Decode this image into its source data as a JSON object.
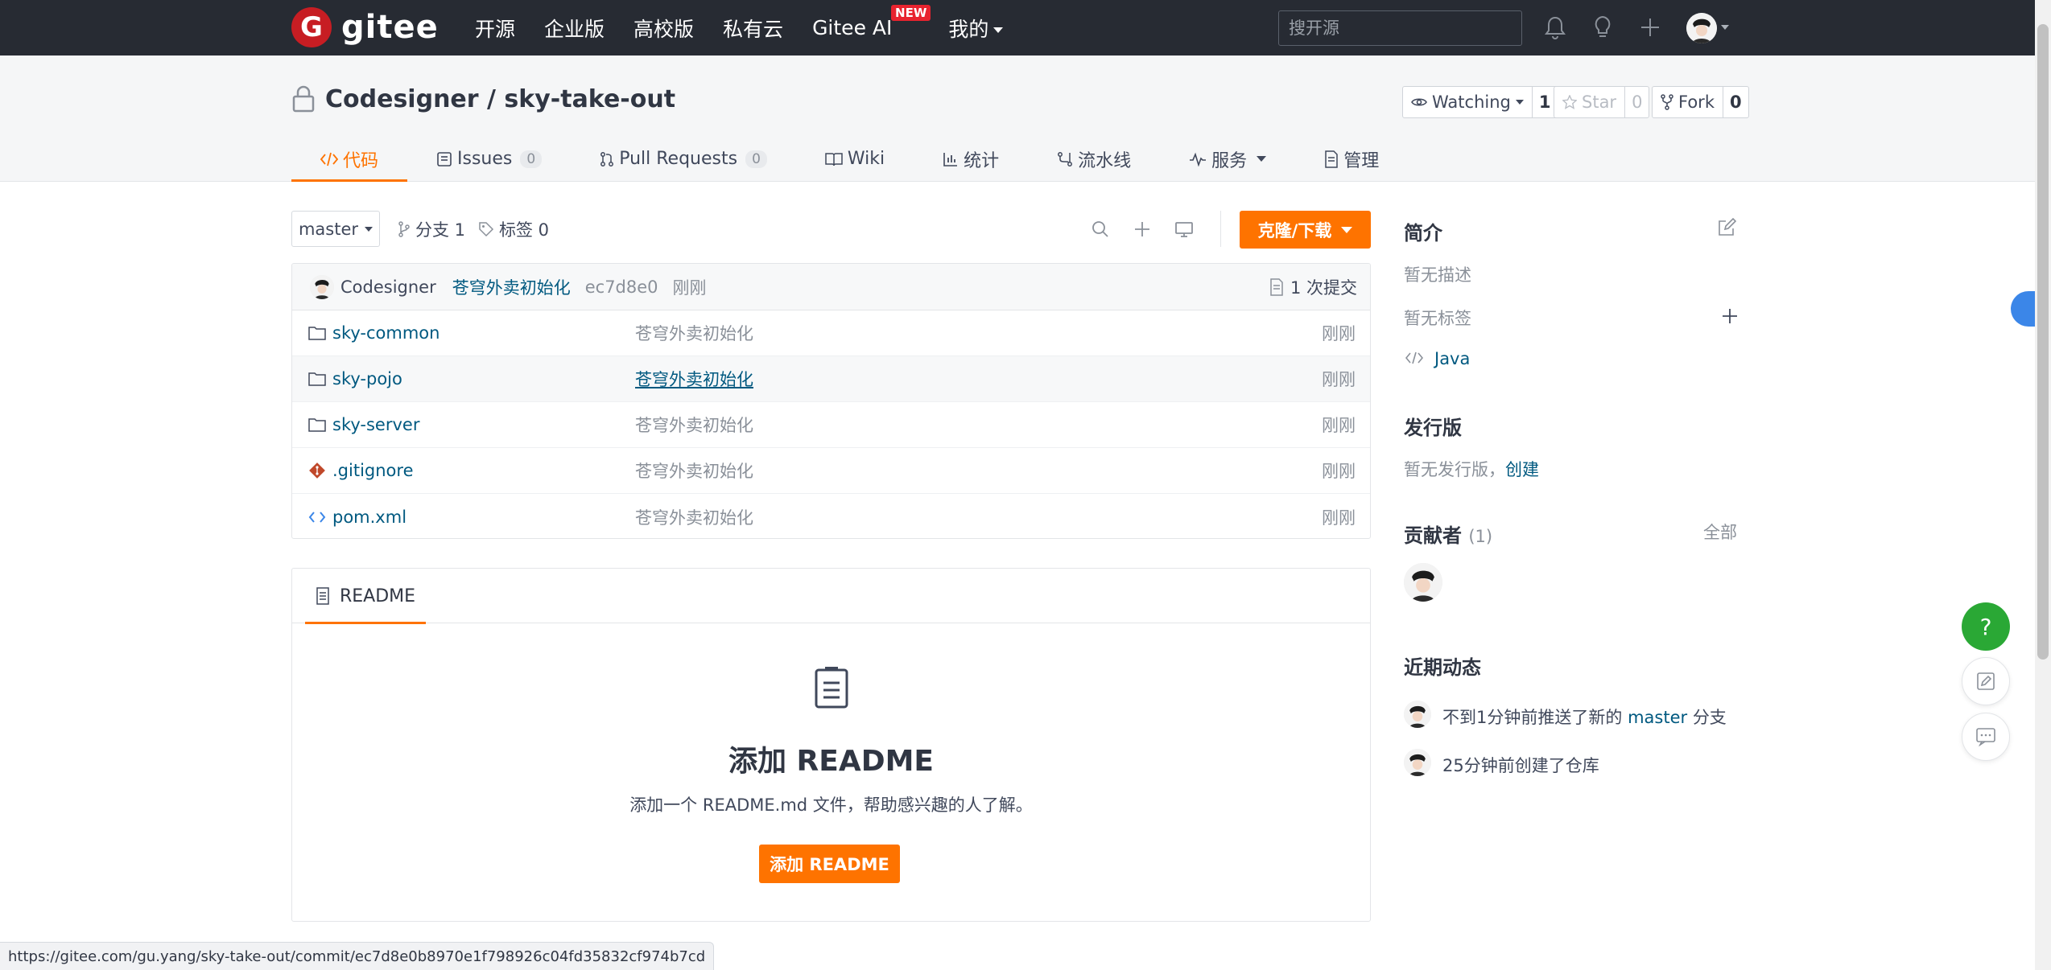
{
  "topnav": {
    "logo_text": "gitee",
    "items": [
      "开源",
      "企业版",
      "高校版",
      "私有云",
      "Gitee AI",
      "我的"
    ],
    "new_badge": "NEW",
    "search_placeholder": "搜开源"
  },
  "repo": {
    "title": "Codesigner / sky-take-out",
    "watching_label": "Watching",
    "watching_count": "1",
    "star_label": "Star",
    "star_count": "0",
    "fork_label": "Fork",
    "fork_count": "0"
  },
  "tabs": [
    {
      "label": "代码",
      "active": true
    },
    {
      "label": "Issues",
      "badge": "0"
    },
    {
      "label": "Pull Requests",
      "badge": "0"
    },
    {
      "label": "Wiki"
    },
    {
      "label": "统计"
    },
    {
      "label": "流水线"
    },
    {
      "label": "服务"
    },
    {
      "label": "管理"
    }
  ],
  "toolbar": {
    "branch": "master",
    "branches_label": "分支 1",
    "tags_label": "标签 0",
    "clone_label": "克隆/下载"
  },
  "last_commit": {
    "author": "Codesigner",
    "message": "苍穹外卖初始化",
    "sha": "ec7d8e0",
    "time": "刚刚",
    "count_label": "1 次提交"
  },
  "files": [
    {
      "name": "sky-common",
      "type": "folder",
      "commit": "苍穹外卖初始化",
      "time": "刚刚"
    },
    {
      "name": "sky-pojo",
      "type": "folder",
      "commit": "苍穹外卖初始化",
      "time": "刚刚"
    },
    {
      "name": "sky-server",
      "type": "folder",
      "commit": "苍穹外卖初始化",
      "time": "刚刚"
    },
    {
      "name": ".gitignore",
      "type": "git",
      "commit": "苍穹外卖初始化",
      "time": "刚刚"
    },
    {
      "name": "pom.xml",
      "type": "code",
      "commit": "苍穹外卖初始化",
      "time": "刚刚"
    }
  ],
  "readme": {
    "tab_label": "README",
    "title": "添加 README",
    "description": "添加一个 README.md 文件，帮助感兴趣的人了解。",
    "button": "添加 README"
  },
  "sidebar": {
    "intro_title": "简介",
    "no_description": "暂无描述",
    "no_tags": "暂无标签",
    "language": "Java",
    "releases_title": "发行版",
    "no_release": "暂无发行版，",
    "create_link": "创建",
    "contributors_title": "贡献者",
    "contributors_count": "(1)",
    "all_link": "全部",
    "activity_title": "近期动态",
    "activity": [
      {
        "prefix": "不到1分钟前推送了新的",
        "branch": "master",
        "suffix": "分支"
      },
      {
        "prefix": "25分钟前创建了仓库",
        "branch": "",
        "suffix": ""
      }
    ]
  },
  "status_url": "https://gitee.com/gu.yang/sky-take-out/commit/ec7d8e0b8970e1f798926c04fd35832cf974b7cd",
  "colors": {
    "brand": "#c71d23",
    "accent": "#fe7300",
    "link": "#005980",
    "topbar": "#272b33",
    "help": "#2aa835"
  }
}
